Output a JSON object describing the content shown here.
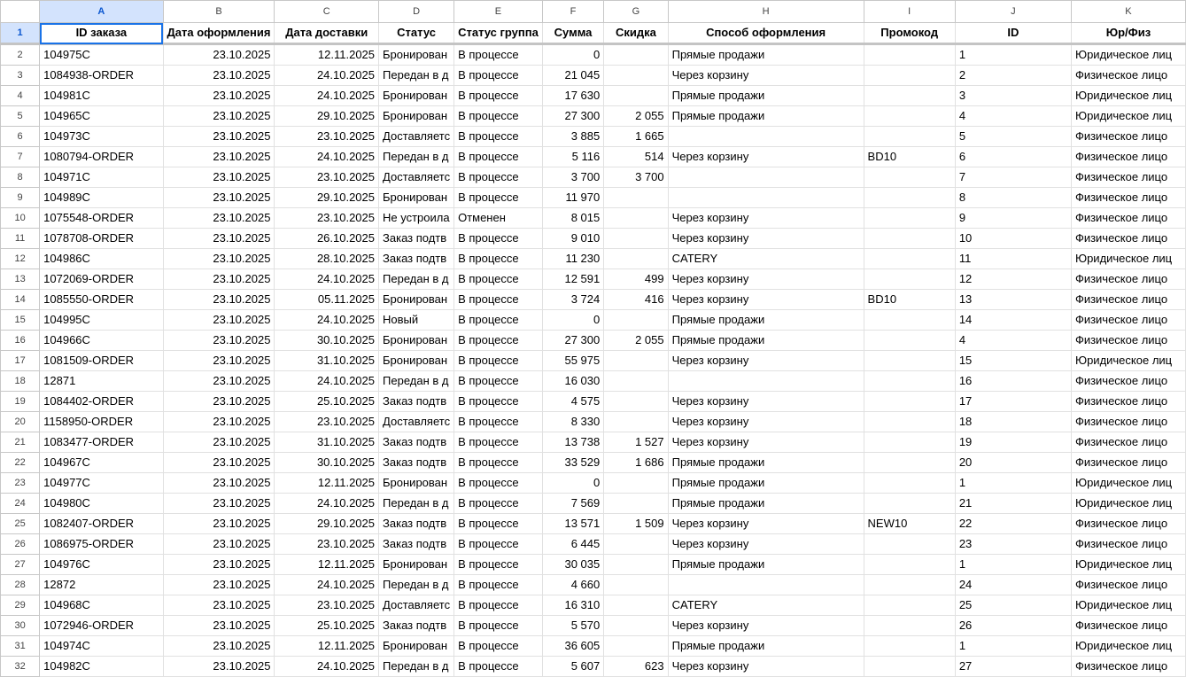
{
  "columns": [
    "A",
    "B",
    "C",
    "D",
    "E",
    "F",
    "G",
    "H",
    "I",
    "J",
    "K"
  ],
  "selected_cell": "A1",
  "headers": [
    "ID заказа",
    "Дата оформления",
    "Дата доставки",
    "Статус",
    "Статус группа",
    "Сумма",
    "Скидка",
    "Способ оформления",
    "Промокод",
    "ID",
    "Юр/Физ"
  ],
  "rows": [
    {
      "n": "2",
      "c": [
        "104975C",
        "23.10.2025",
        "12.11.2025",
        "Бронирован",
        "В процессе",
        "0",
        "",
        "Прямые продажи",
        "",
        "1",
        "Юридическое лиц"
      ]
    },
    {
      "n": "3",
      "c": [
        "1084938-ORDER",
        "23.10.2025",
        "24.10.2025",
        "Передан в д",
        "В процессе",
        "21 045",
        "",
        "Через корзину",
        "",
        "2",
        "Физическое лицо"
      ]
    },
    {
      "n": "4",
      "c": [
        "104981C",
        "23.10.2025",
        "24.10.2025",
        "Бронирован",
        "В процессе",
        "17 630",
        "",
        "Прямые продажи",
        "",
        "3",
        "Юридическое лиц"
      ]
    },
    {
      "n": "5",
      "c": [
        "104965C",
        "23.10.2025",
        "29.10.2025",
        "Бронирован",
        "В процессе",
        "27 300",
        "2 055",
        "Прямые продажи",
        "",
        "4",
        "Юридическое лиц"
      ]
    },
    {
      "n": "6",
      "c": [
        "104973C",
        "23.10.2025",
        "23.10.2025",
        "Доставляетс",
        "В процессе",
        "3 885",
        "1 665",
        "",
        "",
        "5",
        "Физическое лицо"
      ]
    },
    {
      "n": "7",
      "c": [
        "1080794-ORDER",
        "23.10.2025",
        "24.10.2025",
        "Передан в д",
        "В процессе",
        "5 116",
        "514",
        "Через корзину",
        "BD10",
        "6",
        "Физическое лицо"
      ]
    },
    {
      "n": "8",
      "c": [
        "104971C",
        "23.10.2025",
        "23.10.2025",
        "Доставляетс",
        "В процессе",
        "3 700",
        "3 700",
        "",
        "",
        "7",
        "Физическое лицо"
      ]
    },
    {
      "n": "9",
      "c": [
        "104989C",
        "23.10.2025",
        "29.10.2025",
        "Бронирован",
        "В процессе",
        "11 970",
        "",
        "",
        "",
        "8",
        "Физическое лицо"
      ]
    },
    {
      "n": "10",
      "c": [
        "1075548-ORDER",
        "23.10.2025",
        "23.10.2025",
        "Не устроила",
        "Отменен",
        "8 015",
        "",
        "Через корзину",
        "",
        "9",
        "Физическое лицо"
      ]
    },
    {
      "n": "11",
      "c": [
        "1078708-ORDER",
        "23.10.2025",
        "26.10.2025",
        "Заказ подтв",
        "В процессе",
        "9 010",
        "",
        "Через корзину",
        "",
        "10",
        "Физическое лицо"
      ]
    },
    {
      "n": "12",
      "c": [
        "104986C",
        "23.10.2025",
        "28.10.2025",
        "Заказ подтв",
        "В процессе",
        "11 230",
        "",
        "CATERY",
        "",
        "11",
        "Юридическое лиц"
      ]
    },
    {
      "n": "13",
      "c": [
        "1072069-ORDER",
        "23.10.2025",
        "24.10.2025",
        "Передан в д",
        "В процессе",
        "12 591",
        "499",
        "Через корзину",
        "",
        "12",
        "Физическое лицо"
      ]
    },
    {
      "n": "14",
      "c": [
        "1085550-ORDER",
        "23.10.2025",
        "05.11.2025",
        "Бронирован",
        "В процессе",
        "3 724",
        "416",
        "Через корзину",
        "BD10",
        "13",
        "Физическое лицо"
      ]
    },
    {
      "n": "15",
      "c": [
        "104995C",
        "23.10.2025",
        "24.10.2025",
        "Новый",
        "В процессе",
        "0",
        "",
        "Прямые продажи",
        "",
        "14",
        "Физическое лицо"
      ]
    },
    {
      "n": "16",
      "c": [
        "104966C",
        "23.10.2025",
        "30.10.2025",
        "Бронирован",
        "В процессе",
        "27 300",
        "2 055",
        "Прямые продажи",
        "",
        "4",
        "Физическое лицо"
      ]
    },
    {
      "n": "17",
      "c": [
        "1081509-ORDER",
        "23.10.2025",
        "31.10.2025",
        "Бронирован",
        "В процессе",
        "55 975",
        "",
        "Через корзину",
        "",
        "15",
        "Юридическое лиц"
      ]
    },
    {
      "n": "18",
      "c": [
        "12871",
        "23.10.2025",
        "24.10.2025",
        "Передан в д",
        "В процессе",
        "16 030",
        "",
        "",
        "",
        "16",
        "Физическое лицо"
      ]
    },
    {
      "n": "19",
      "c": [
        "1084402-ORDER",
        "23.10.2025",
        "25.10.2025",
        "Заказ подтв",
        "В процессе",
        "4 575",
        "",
        "Через корзину",
        "",
        "17",
        "Физическое лицо"
      ]
    },
    {
      "n": "20",
      "c": [
        "1158950-ORDER",
        "23.10.2025",
        "23.10.2025",
        "Доставляетс",
        "В процессе",
        "8 330",
        "",
        "Через корзину",
        "",
        "18",
        "Физическое лицо"
      ]
    },
    {
      "n": "21",
      "c": [
        "1083477-ORDER",
        "23.10.2025",
        "31.10.2025",
        "Заказ подтв",
        "В процессе",
        "13 738",
        "1 527",
        "Через корзину",
        "",
        "19",
        "Физическое лицо"
      ]
    },
    {
      "n": "22",
      "c": [
        "104967C",
        "23.10.2025",
        "30.10.2025",
        "Заказ подтв",
        "В процессе",
        "33 529",
        "1 686",
        "Прямые продажи",
        "",
        "20",
        "Физическое лицо"
      ]
    },
    {
      "n": "23",
      "c": [
        "104977C",
        "23.10.2025",
        "12.11.2025",
        "Бронирован",
        "В процессе",
        "0",
        "",
        "Прямые продажи",
        "",
        "1",
        "Юридическое лиц"
      ]
    },
    {
      "n": "24",
      "c": [
        "104980C",
        "23.10.2025",
        "24.10.2025",
        "Передан в д",
        "В процессе",
        "7 569",
        "",
        "Прямые продажи",
        "",
        "21",
        "Юридическое лиц"
      ]
    },
    {
      "n": "25",
      "c": [
        "1082407-ORDER",
        "23.10.2025",
        "29.10.2025",
        "Заказ подтв",
        "В процессе",
        "13 571",
        "1 509",
        "Через корзину",
        "NEW10",
        "22",
        "Физическое лицо"
      ]
    },
    {
      "n": "26",
      "c": [
        "1086975-ORDER",
        "23.10.2025",
        "23.10.2025",
        "Заказ подтв",
        "В процессе",
        "6 445",
        "",
        "Через корзину",
        "",
        "23",
        "Физическое лицо"
      ]
    },
    {
      "n": "27",
      "c": [
        "104976C",
        "23.10.2025",
        "12.11.2025",
        "Бронирован",
        "В процессе",
        "30 035",
        "",
        "Прямые продажи",
        "",
        "1",
        "Юридическое лиц"
      ]
    },
    {
      "n": "28",
      "c": [
        "12872",
        "23.10.2025",
        "24.10.2025",
        "Передан в д",
        "В процессе",
        "4 660",
        "",
        "",
        "",
        "24",
        "Физическое лицо"
      ]
    },
    {
      "n": "29",
      "c": [
        "104968C",
        "23.10.2025",
        "23.10.2025",
        "Доставляетс",
        "В процессе",
        "16 310",
        "",
        "CATERY",
        "",
        "25",
        "Юридическое лиц"
      ]
    },
    {
      "n": "30",
      "c": [
        "1072946-ORDER",
        "23.10.2025",
        "25.10.2025",
        "Заказ подтв",
        "В процессе",
        "5 570",
        "",
        "Через корзину",
        "",
        "26",
        "Физическое лицо"
      ]
    },
    {
      "n": "31",
      "c": [
        "104974C",
        "23.10.2025",
        "12.11.2025",
        "Бронирован",
        "В процессе",
        "36 605",
        "",
        "Прямые продажи",
        "",
        "1",
        "Юридическое лиц"
      ]
    },
    {
      "n": "32",
      "c": [
        "104982C",
        "23.10.2025",
        "24.10.2025",
        "Передан в д",
        "В процессе",
        "5 607",
        "623",
        "Через корзину",
        "",
        "27",
        "Физическое лицо"
      ]
    }
  ]
}
